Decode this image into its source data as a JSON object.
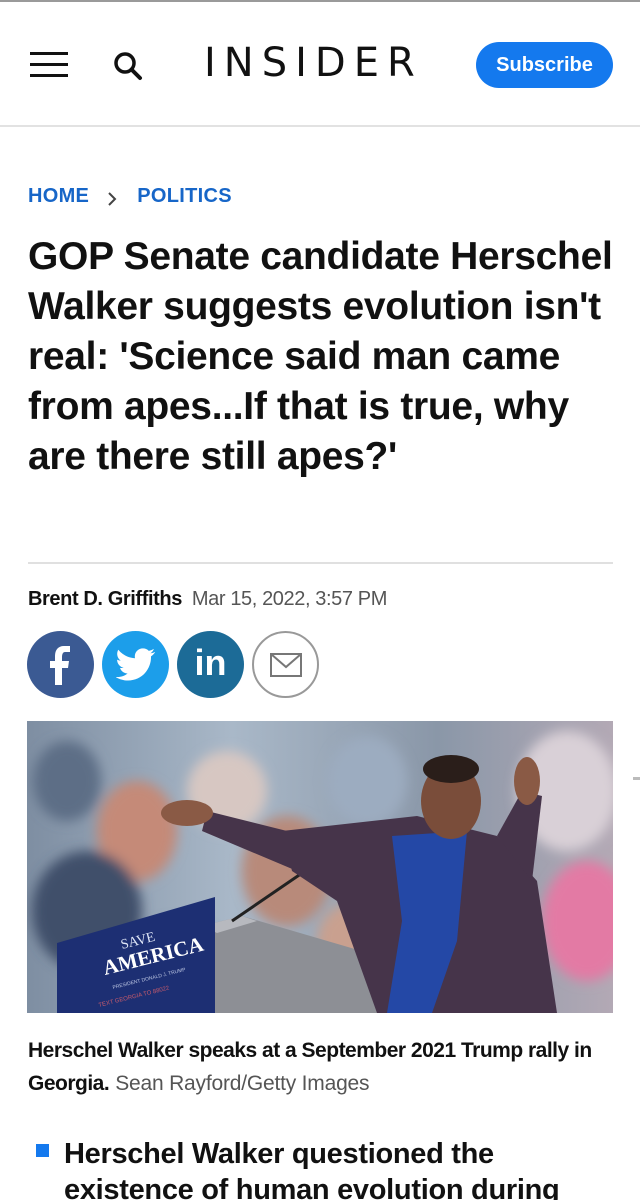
{
  "header": {
    "logo": "INSIDER",
    "subscribe_label": "Subscribe",
    "menu_icon": "hamburger-menu-icon",
    "search_icon": "search-icon"
  },
  "breadcrumb": {
    "home": "HOME",
    "section": "POLITICS"
  },
  "article": {
    "headline": "GOP Senate candidate Herschel Walker suggests evolution isn't real: 'Science said man came from apes...If that is true, why are there still apes?'",
    "author": "Brent D. Griffiths",
    "date": "Mar 15, 2022, 3:57 PM"
  },
  "share": {
    "facebook_icon": "facebook-icon",
    "twitter_icon": "twitter-icon",
    "linkedin_icon": "linkedin-icon",
    "email_icon": "email-icon",
    "linkedin_label": "in"
  },
  "photo": {
    "podium_line1": "SAVE",
    "podium_line2": "AMERICA",
    "podium_line3": "PRESIDENT DONALD J. TRUMP",
    "podium_line4": "TEXT GEORGIA TO 88022",
    "caption": "Herschel Walker speaks at a September 2021 Trump rally in Georgia.",
    "credit": "Sean Rayford/Getty Images"
  },
  "key_points": [
    "Herschel Walker questioned the existence of human evolution during"
  ],
  "colors": {
    "brand_blue": "#1479ee",
    "link_blue": "#1766c8",
    "facebook": "#3b5a93",
    "twitter": "#1c9eea",
    "linkedin": "#1c6b97"
  }
}
